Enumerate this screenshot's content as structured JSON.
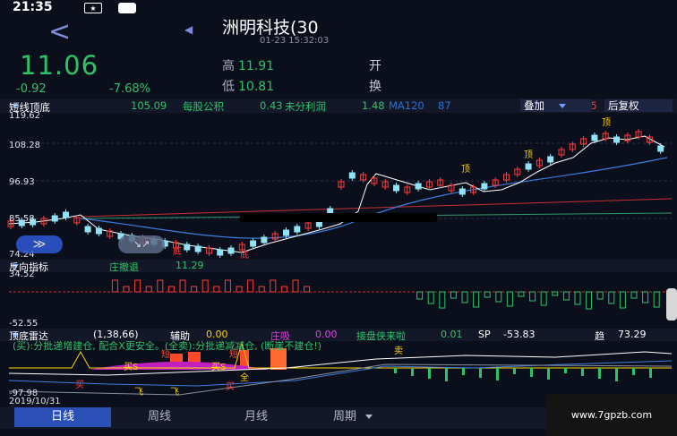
{
  "status": {
    "time": "21:35",
    "icon1": "notification-icon",
    "icon2": "message-icon"
  },
  "header": {
    "back": "<",
    "stock_name": "洲明科技(30",
    "datetime": "01-23 15:32:03"
  },
  "quote": {
    "price": "11.06",
    "change": "-0.92",
    "change_pct": "-7.68%",
    "high_label": "高",
    "high": "11.91",
    "low_label": "低",
    "low": "10.81",
    "open_label": "开",
    "turnover_label": "换"
  },
  "main_tabbar": {
    "indicator": "短线顶底",
    "vals": "105.09",
    "eps_label": "每股公积",
    "eps": "0.43",
    "undist_label": "未分利润",
    "undist": "1.48",
    "ma": "MA120",
    "ma_val": "87",
    "overlay": "叠加",
    "red": "25",
    "adjust": "后复权"
  },
  "main_axis": {
    "max": "119.62",
    "y2": "108.28",
    "y3": "96.93",
    "y4": "85.58",
    "min": "74.24"
  },
  "main_labels": {
    "top": "顶",
    "bottom": "底"
  },
  "sub1_tabbar": {
    "name": "反向指标",
    "label": "庄撤退",
    "value": "11.29"
  },
  "sub1_axis": {
    "max": "34.52",
    "min": "-52.55"
  },
  "sub2_tabbar": {
    "name": "顶底雷达",
    "params": "(1,38,66)",
    "aux_label": "辅助",
    "aux": "0.00",
    "zx_label": "庄吸",
    "zx": "0.00",
    "jp_label": "接盘侠来啦",
    "jp": "0.01",
    "sp_label": "SP",
    "sp": "-53.83",
    "trend_label": "趋",
    "trend": "73.29"
  },
  "sub2_text": "(买):分批递增建仓, 配合X更安全。(全卖):分批递减减仓, (断崖不建仓!)",
  "sub2_marks": {
    "sell": "卖",
    "buy": "买",
    "fly": "飞",
    "all": "全",
    "short": "短",
    "buy_s": "买S"
  },
  "sub2_axis": {
    "min": "-97.98"
  },
  "date": "2019/10/31",
  "bottom_tabs": [
    "日线",
    "周线",
    "月线",
    "周期"
  ],
  "watermark": "www.7gpzb.com",
  "colors": {
    "up": "#ff3b3b",
    "down": "#2cc36b",
    "candle_down": "#8fe3f5",
    "accent": "#2a4fb6"
  }
}
